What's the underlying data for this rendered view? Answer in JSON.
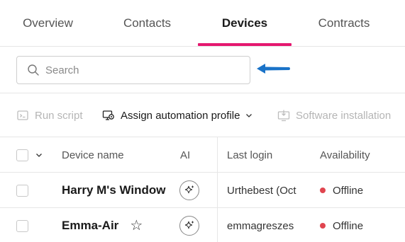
{
  "tabs": [
    {
      "label": "Overview"
    },
    {
      "label": "Contacts"
    },
    {
      "label": "Devices"
    },
    {
      "label": "Contracts"
    }
  ],
  "active_tab": "Devices",
  "accent_color": "#e5176f",
  "search": {
    "placeholder": "Search",
    "value": ""
  },
  "annotation_arrow_color": "#1a73c8",
  "toolbar": {
    "run_script": "Run script",
    "assign_profile": "Assign automation profile",
    "software_installation": "Software installation"
  },
  "table": {
    "headers": {
      "device_name": "Device name",
      "ai": "AI",
      "last_login": "Last login",
      "availability": "Availability"
    },
    "rows": [
      {
        "device_name": "Harry M's Window",
        "last_login": "Urthebest (Oct",
        "availability": "Offline",
        "favorite": false
      },
      {
        "device_name": "Emma-Air",
        "last_login": "emmagreszes",
        "availability": "Offline",
        "favorite": true
      }
    ],
    "status_colors": {
      "Offline": "#e0454f"
    }
  }
}
